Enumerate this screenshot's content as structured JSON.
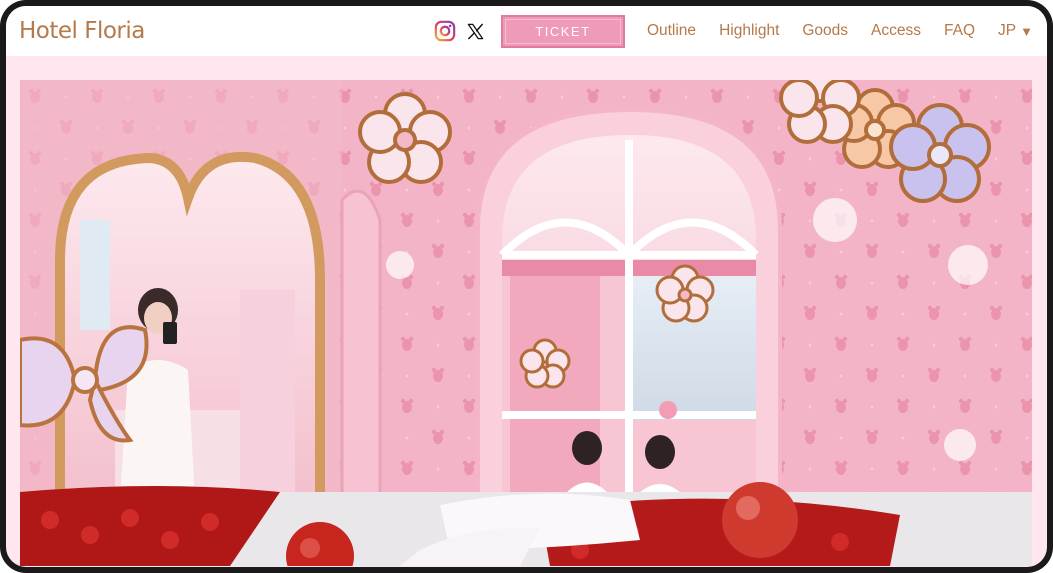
{
  "header": {
    "logo_text": "Hotel Floria",
    "social": [
      {
        "icon": "instagram-icon"
      },
      {
        "icon": "x-icon"
      }
    ],
    "ticket_label": "TICKET",
    "nav": [
      {
        "label": "Outline"
      },
      {
        "label": "Highlight"
      },
      {
        "label": "Goods"
      },
      {
        "label": "Access"
      },
      {
        "label": "FAQ"
      }
    ],
    "language": {
      "label": "JP",
      "icon": "triangle-down-icon"
    }
  },
  "colors": {
    "brand_brown": "#b5794a",
    "ticket_pink": "#ef9ab8",
    "background_pink": "#ffe6ef"
  }
}
